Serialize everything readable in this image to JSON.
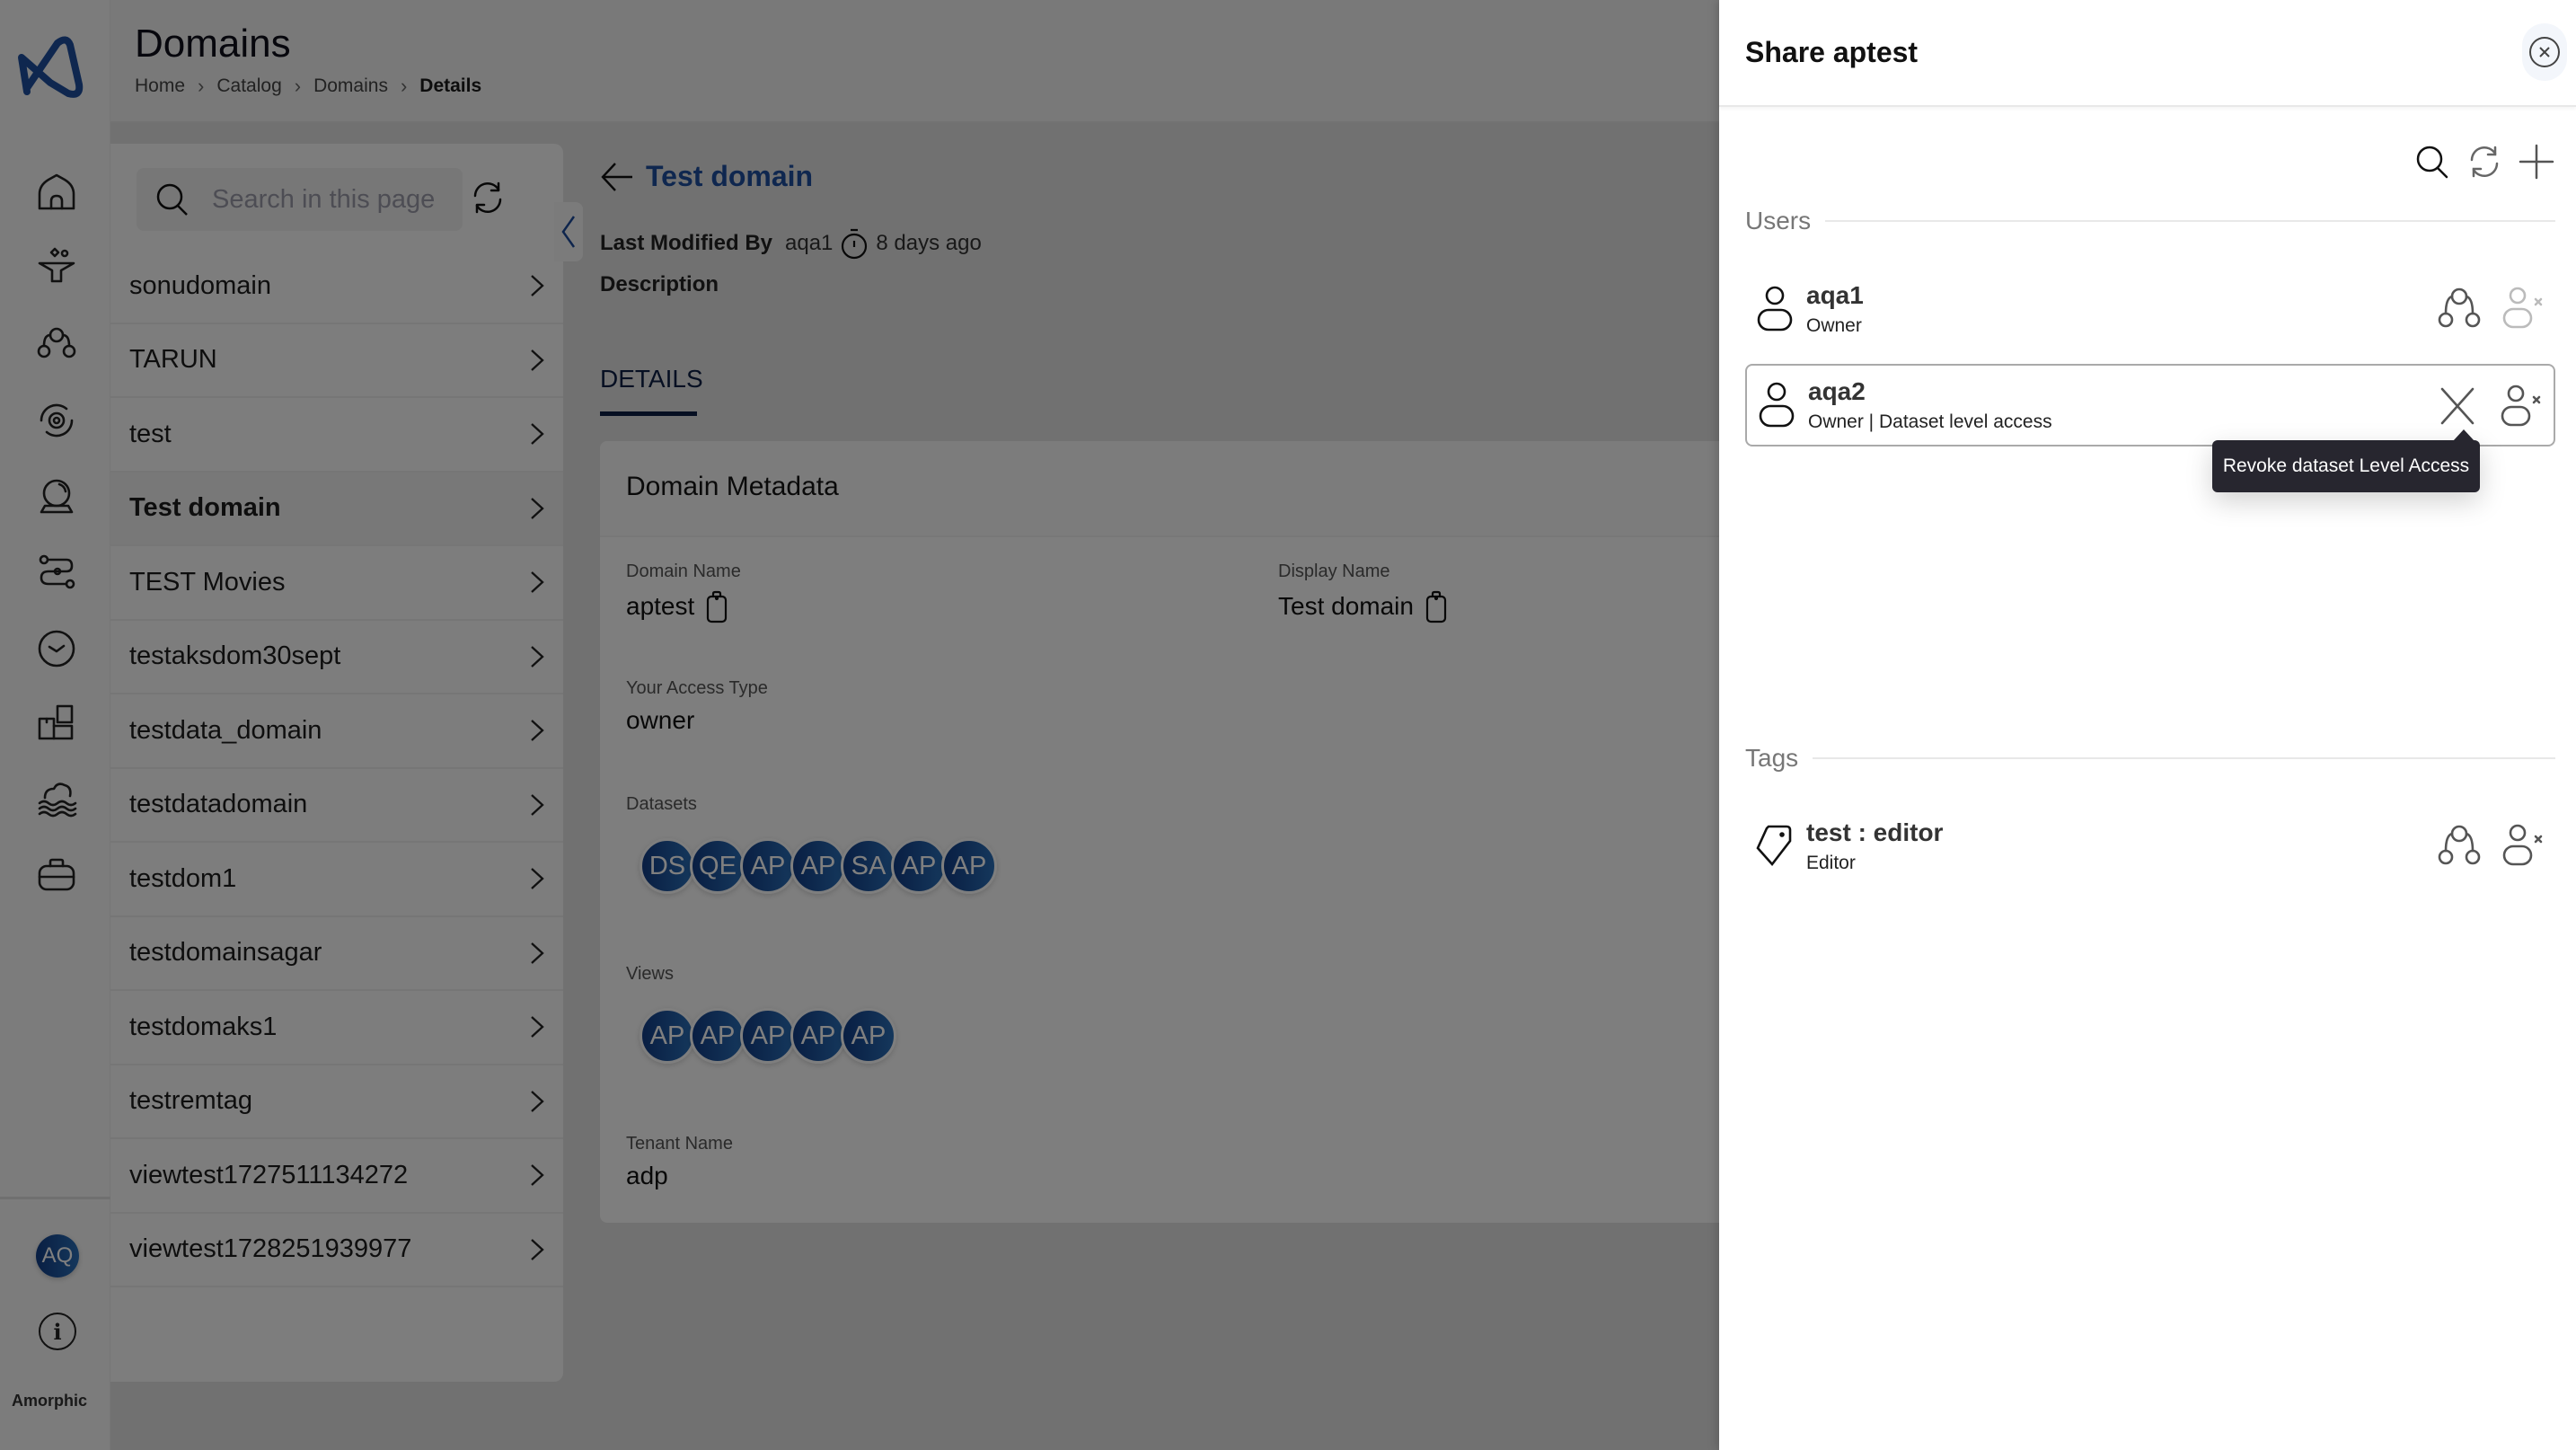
{
  "app": {
    "brand": "Amorphic",
    "user_initials": "AQ"
  },
  "nav": {
    "items": [
      {
        "icon": "home-icon"
      },
      {
        "icon": "ingest-funnel-icon"
      },
      {
        "icon": "hierarchy-icon"
      },
      {
        "icon": "settings-cycle-icon"
      },
      {
        "icon": "crystal-ball-icon"
      },
      {
        "icon": "workflow-icon"
      },
      {
        "icon": "clock-icon"
      },
      {
        "icon": "puzzle-icon"
      },
      {
        "icon": "data-lake-icon"
      },
      {
        "icon": "briefcase-icon"
      }
    ]
  },
  "header": {
    "title": "Domains",
    "breadcrumb": [
      "Home",
      "Catalog",
      "Domains",
      "Details"
    ]
  },
  "list": {
    "search_placeholder": "Search in this page",
    "items": [
      {
        "label": "sonudomain",
        "selected": false
      },
      {
        "label": "TARUN",
        "selected": false
      },
      {
        "label": "test",
        "selected": false
      },
      {
        "label": "Test domain",
        "selected": true
      },
      {
        "label": "TEST Movies",
        "selected": false
      },
      {
        "label": "testaksdom30sept",
        "selected": false
      },
      {
        "label": "testdata_domain",
        "selected": false
      },
      {
        "label": "testdatadomain",
        "selected": false
      },
      {
        "label": "testdom1",
        "selected": false
      },
      {
        "label": "testdomainsagar",
        "selected": false
      },
      {
        "label": "testdomaks1",
        "selected": false
      },
      {
        "label": "testremtag",
        "selected": false
      },
      {
        "label": "viewtest1727511134272",
        "selected": false
      },
      {
        "label": "viewtest1728251939977",
        "selected": false
      }
    ]
  },
  "detail": {
    "title": "Test domain",
    "last_modified_label": "Last Modified By",
    "last_modified_user": "aqa1",
    "last_modified_time": "8 days ago",
    "description_label": "Description",
    "tab": "DETAILS",
    "card_title": "Domain Metadata",
    "domain_name_label": "Domain Name",
    "domain_name": "aptest",
    "display_name_label": "Display Name",
    "display_name": "Test domain",
    "access_type_label": "Your Access Type",
    "access_type": "owner",
    "datasets_label": "Datasets",
    "datasets": [
      "DS",
      "QE",
      "AP",
      "AP",
      "SA",
      "AP",
      "AP"
    ],
    "views_label": "Views",
    "views": [
      "AP",
      "AP",
      "AP",
      "AP",
      "AP"
    ],
    "tenant_label": "Tenant Name",
    "tenant": "adp"
  },
  "share": {
    "title": "Share aptest",
    "users_label": "Users",
    "users": [
      {
        "name": "aqa1",
        "role": "Owner"
      },
      {
        "name": "aqa2",
        "role": "Owner | Dataset level access"
      }
    ],
    "tags_label": "Tags",
    "tags": [
      {
        "name": "test : editor",
        "role": "Editor"
      }
    ],
    "tooltip": "Revoke dataset Level Access",
    "colors": {
      "accent": "#1f4f9f",
      "tooltip_bg": "#27262f"
    }
  }
}
